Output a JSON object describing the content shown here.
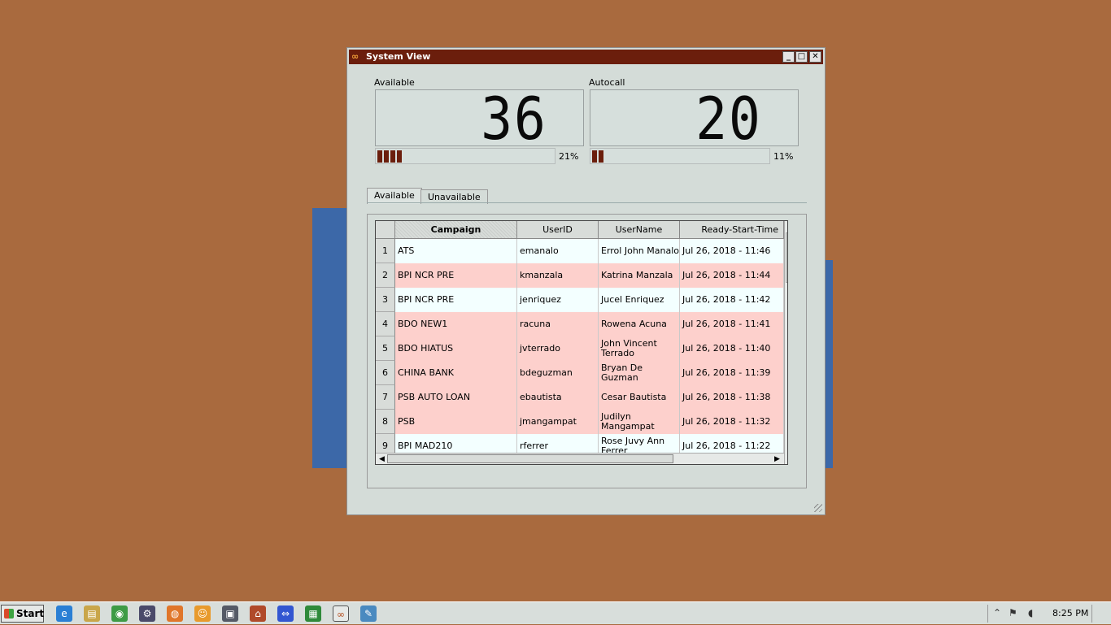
{
  "window": {
    "title": "System View",
    "min_glyph": "_",
    "max_glyph": "□",
    "close_glyph": "✕"
  },
  "meters": {
    "available": {
      "label": "Available",
      "value": "36",
      "percent_text": "21%",
      "fill": 0.21
    },
    "autocall": {
      "label": "Autocall",
      "value": "20",
      "percent_text": "11%",
      "fill": 0.11
    }
  },
  "tabs": [
    {
      "label": "Available",
      "active": true
    },
    {
      "label": "Unavailable",
      "active": false
    }
  ],
  "table": {
    "columns": [
      "Campaign",
      "UserID",
      "UserName",
      "Ready-Start-Time"
    ],
    "rows": [
      {
        "num": "1",
        "campaign": "ATS",
        "userid": "emanalo",
        "username": "Errol John Manalo",
        "time": "Jul 26, 2018 - 11:46",
        "tone": "light"
      },
      {
        "num": "2",
        "campaign": "BPI NCR PRE",
        "userid": "kmanzala",
        "username": "Katrina Manzala",
        "time": "Jul 26, 2018 - 11:44",
        "tone": "pink"
      },
      {
        "num": "3",
        "campaign": "BPI NCR PRE",
        "userid": "jenriquez",
        "username": "Jucel Enriquez",
        "time": "Jul 26, 2018 - 11:42",
        "tone": "light"
      },
      {
        "num": "4",
        "campaign": "BDO NEW1",
        "userid": "racuna",
        "username": "Rowena Acuna",
        "time": "Jul 26, 2018 - 11:41",
        "tone": "pink"
      },
      {
        "num": "5",
        "campaign": "BDO HIATUS",
        "userid": "jvterrado",
        "username": "John Vincent Terrado",
        "time": "Jul 26, 2018 - 11:40",
        "tone": "pink"
      },
      {
        "num": "6",
        "campaign": "CHINA BANK",
        "userid": "bdeguzman",
        "username": "Bryan De Guzman",
        "time": "Jul 26, 2018 - 11:39",
        "tone": "pink"
      },
      {
        "num": "7",
        "campaign": "PSB AUTO LOAN",
        "userid": "ebautista",
        "username": "Cesar Bautista",
        "time": "Jul 26, 2018 - 11:38",
        "tone": "pink"
      },
      {
        "num": "8",
        "campaign": "PSB",
        "userid": "jmangampat",
        "username": "Judilyn Mangampat",
        "time": "Jul 26, 2018 - 11:32",
        "tone": "pink"
      },
      {
        "num": "9",
        "campaign": "BPI MAD210",
        "userid": "rferrer",
        "username": "Rose Juvy Ann Ferrer",
        "time": "Jul 26, 2018 - 11:22",
        "tone": "light"
      }
    ]
  },
  "taskbar": {
    "start_label": "Start",
    "apps": [
      {
        "icon": "internet-explorer-icon",
        "glyph": "e",
        "color": "#2a7fd4"
      },
      {
        "icon": "file-explorer-icon",
        "glyph": "▤",
        "color": "#c9a64a"
      },
      {
        "icon": "chrome-icon",
        "glyph": "◉",
        "color": "#3d9b45"
      },
      {
        "icon": "network-tool-icon",
        "glyph": "⚙",
        "color": "#4a4a6a"
      },
      {
        "icon": "firefox-icon",
        "glyph": "◍",
        "color": "#e0762a"
      },
      {
        "icon": "contacts-icon",
        "glyph": "☺",
        "color": "#e89a2c"
      },
      {
        "icon": "remote-desktop-icon",
        "glyph": "▣",
        "color": "#555a66"
      },
      {
        "icon": "network-map-icon",
        "glyph": "⌂",
        "color": "#b04a2a"
      },
      {
        "icon": "teamviewer-icon",
        "glyph": "⇔",
        "color": "#3256d1"
      },
      {
        "icon": "spreadsheet-icon",
        "glyph": "▦",
        "color": "#2f8a3a"
      },
      {
        "icon": "system-view-app-icon",
        "glyph": "∞",
        "color": "#b34a1a"
      },
      {
        "icon": "notepad-icon",
        "glyph": "✎",
        "color": "#4a8ac0"
      }
    ],
    "clock": "8:25 PM"
  }
}
